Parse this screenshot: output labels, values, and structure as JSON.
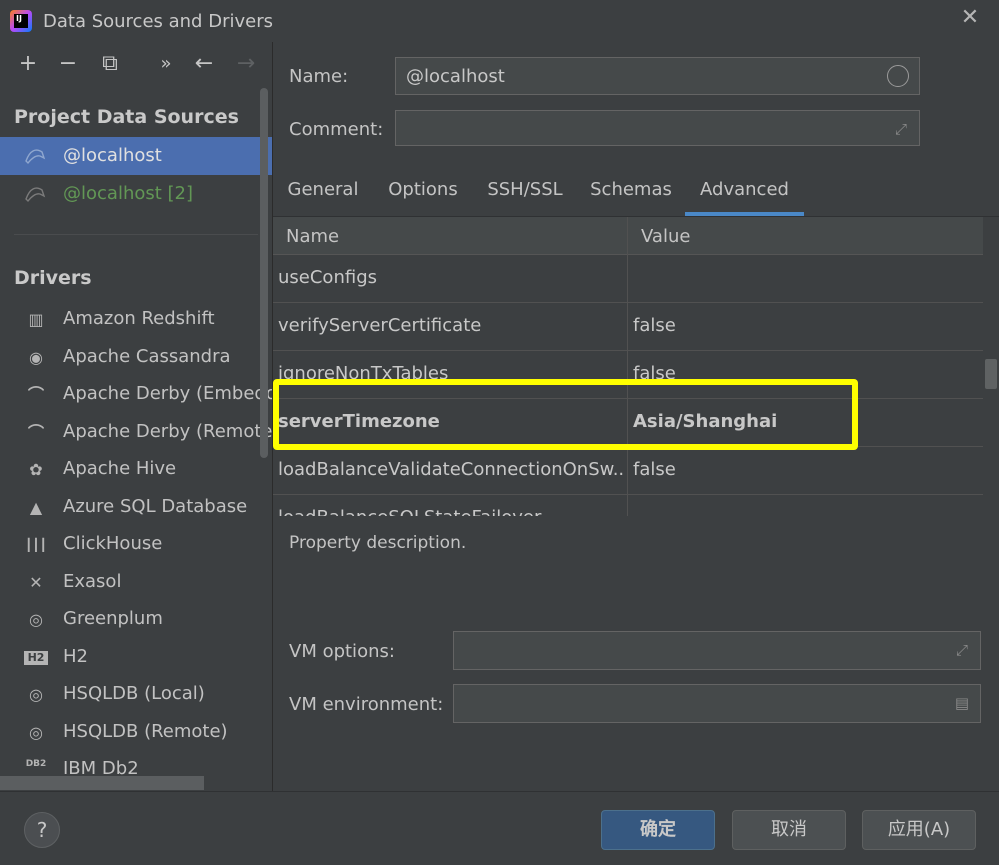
{
  "window": {
    "title": "Data Sources and Drivers",
    "close_glyph": "✕",
    "logo_text": "IJ"
  },
  "toolbar": {
    "add": "+",
    "remove": "−",
    "duplicate": "⧉",
    "more": "»",
    "back": "←",
    "forward": "→"
  },
  "sidebar": {
    "project_header": "Project Data Sources",
    "data_sources": [
      {
        "label": "@localhost",
        "selected": true,
        "color": "#c8c8c8"
      },
      {
        "label": "@localhost [2]",
        "selected": false,
        "color": "#629755"
      }
    ],
    "drivers_header": "Drivers",
    "drivers": [
      {
        "label": "Amazon Redshift",
        "icon": "redshift-icon",
        "glyph": "▥"
      },
      {
        "label": "Apache Cassandra",
        "icon": "cassandra-icon",
        "glyph": "◉"
      },
      {
        "label": "Apache Derby (Embedded)",
        "icon": "derby-icon",
        "glyph": "⌒"
      },
      {
        "label": "Apache Derby (Remote)",
        "icon": "derby-icon",
        "glyph": "⌒"
      },
      {
        "label": "Apache Hive",
        "icon": "hive-icon",
        "glyph": "✿"
      },
      {
        "label": "Azure SQL Database",
        "icon": "azure-icon",
        "glyph": "▲"
      },
      {
        "label": "ClickHouse",
        "icon": "clickhouse-icon",
        "glyph": "┃┃┃"
      },
      {
        "label": "Exasol",
        "icon": "exasol-icon",
        "glyph": "✕"
      },
      {
        "label": "Greenplum",
        "icon": "greenplum-icon",
        "glyph": "◎"
      },
      {
        "label": "H2",
        "icon": "h2-icon",
        "glyph": "H2"
      },
      {
        "label": "HSQLDB (Local)",
        "icon": "hsqldb-icon",
        "glyph": "◎"
      },
      {
        "label": "HSQLDB (Remote)",
        "icon": "hsqldb-icon",
        "glyph": "◎"
      },
      {
        "label": "IBM Db2",
        "icon": "db2-icon",
        "glyph": "DB2"
      }
    ]
  },
  "form": {
    "name_label": "Name:",
    "name_value": "@localhost",
    "comment_label": "Comment:",
    "comment_value": ""
  },
  "tabs": [
    {
      "label": "General"
    },
    {
      "label": "Options"
    },
    {
      "label": "SSH/SSL"
    },
    {
      "label": "Schemas"
    },
    {
      "label": "Advanced",
      "active": true
    }
  ],
  "table": {
    "col_name": "Name",
    "col_value": "Value",
    "rows": [
      {
        "name": "useConfigs",
        "value": ""
      },
      {
        "name": "verifyServerCertificate",
        "value": "false"
      },
      {
        "name": "ignoreNonTxTables",
        "value": "false"
      },
      {
        "name": "serverTimezone",
        "value": "Asia/Shanghai",
        "bold": true
      },
      {
        "name": "loadBalanceValidateConnectionOnSw...",
        "value": "false"
      },
      {
        "name": "loadBalanceSQLStateFailover",
        "value": ""
      }
    ]
  },
  "description": "Property description.",
  "vm": {
    "options_label": "VM options:",
    "options_value": "",
    "env_label": "VM environment:",
    "env_value": ""
  },
  "buttons": {
    "help": "?",
    "ok": "确定",
    "cancel": "取消",
    "apply": "应用(A)"
  },
  "colors": {
    "selection": "#4b6eaf",
    "tab_underline": "#4a88c7",
    "highlight": "#ffff00",
    "primary_button": "#365880"
  }
}
